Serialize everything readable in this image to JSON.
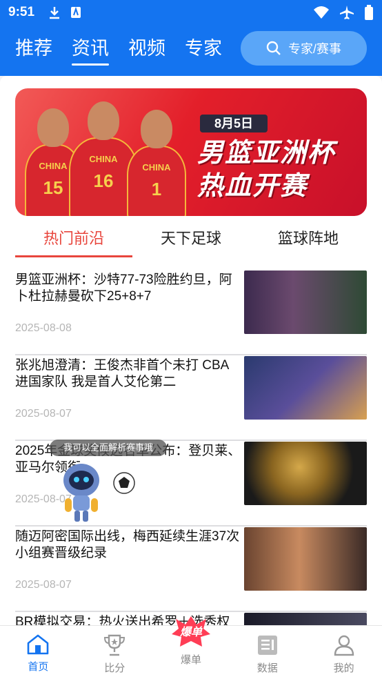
{
  "status": {
    "time": "9:51"
  },
  "topnav": {
    "tabs": [
      "推荐",
      "资讯",
      "视频",
      "专家"
    ],
    "active_index": 1,
    "search_placeholder": "专家/赛事"
  },
  "banner": {
    "date": "8月5日",
    "title_line1": "男篮亚洲杯",
    "title_line2": "热血开赛",
    "players": [
      {
        "jersey": "CHINA",
        "number": "15"
      },
      {
        "jersey": "CHINA",
        "number": "16"
      },
      {
        "jersey": "CHINA",
        "number": "1"
      }
    ]
  },
  "subtabs": [
    "热门前沿",
    "天下足球",
    "篮球阵地"
  ],
  "news": [
    {
      "title": "男篮亚洲杯：沙特77-73险胜约旦，阿卜杜拉赫曼砍下25+8+7",
      "date": "2025-08-08"
    },
    {
      "title": "张兆旭澄清：王俊杰非首个未打 CBA 进国家队 我是首人艾伦第二",
      "date": "2025-08-07"
    },
    {
      "title": "2025年金球奖候选名单公布：登贝莱、亚马尔领衔",
      "date": "2025-08-07"
    },
    {
      "title": "随迈阿密国际出线，梅西延续生涯37次小组赛晋级纪录",
      "date": "2025-08-07"
    },
    {
      "title": "BR模拟交易：热火送出希罗＋选秀权",
      "date": ""
    }
  ],
  "assistant": {
    "tooltip": "我可以全面解析赛事哦"
  },
  "bottomnav": [
    "首页",
    "比分",
    "爆单",
    "数据",
    "我的"
  ],
  "colors": {
    "brand": "#1474f0",
    "accent": "#e8453c"
  }
}
